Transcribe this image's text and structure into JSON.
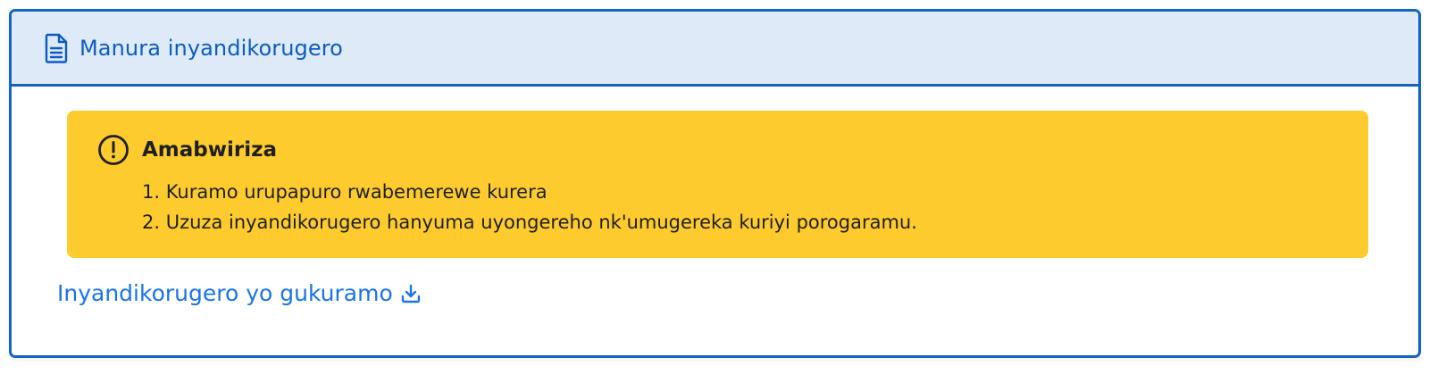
{
  "panel": {
    "title": "Manura inyandikorugero",
    "title_icon": "document-icon"
  },
  "notice": {
    "icon": "exclamation-circle-icon",
    "title": "Amabwiriza",
    "items": [
      "1. Kuramo urupapuro rwabemerewe kurera",
      "2. Uzuza inyandikorugero hanyuma uyongereho nk'umugereka kuriyi porogaramu."
    ]
  },
  "download": {
    "label": "Inyandikorugero yo gukuramo",
    "icon": "download-icon"
  },
  "colors": {
    "accent": "#1565c0",
    "header_bg": "#dfeaf8",
    "notice_bg": "#fdcb2e",
    "link": "#1a73e8"
  }
}
